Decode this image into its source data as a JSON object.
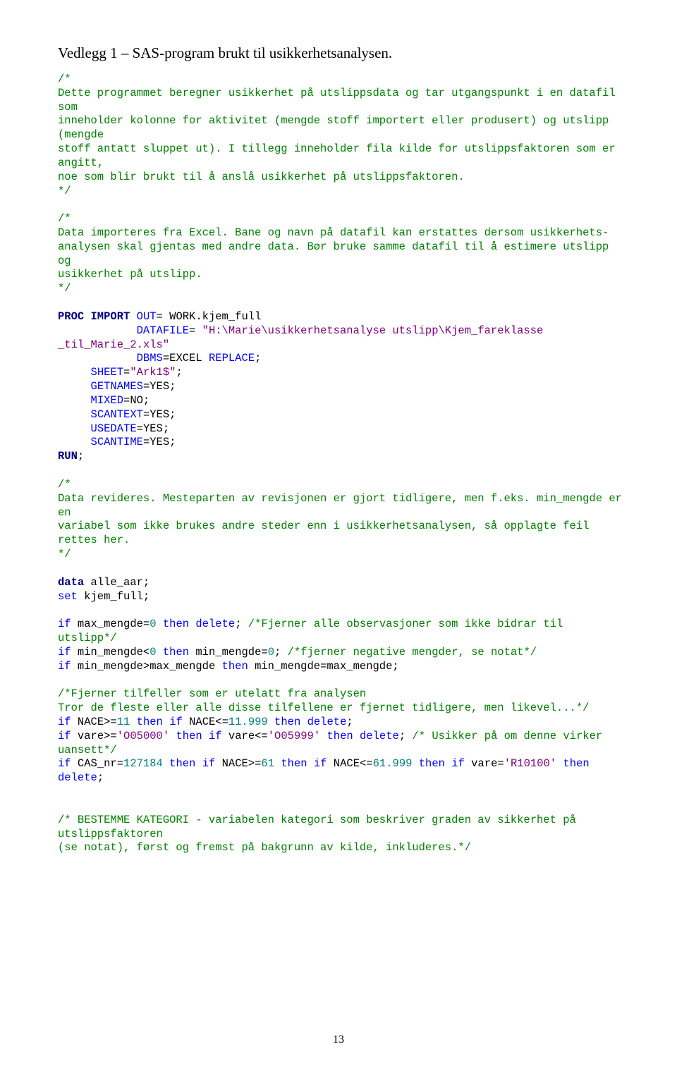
{
  "heading": "Vedlegg 1 – SAS-program brukt til usikkerhetsanalysen.",
  "page_number": "13",
  "code_spans": [
    {
      "cls": "c-green",
      "text": "/*\nDette programmet beregner usikkerhet på utslippsdata og tar utgangspunkt i en datafil som\ninneholder kolonne for aktivitet (mengde stoff importert eller produsert) og utslipp (mengde\nstoff antatt sluppet ut). I tillegg inneholder fila kilde for utslippsfaktoren som er angitt,\nnoe som blir brukt til å anslå usikkerhet på utslippsfaktoren.\n*/\n\n/*\nData importeres fra Excel. Bane og navn på datafil kan erstattes dersom usikkerhets-\nanalysen skal gjentas med andre data. Bør bruke samme datafil til å estimere utslipp og\nusikkerhet på utslipp.\n*/\n"
    },
    {
      "cls": "c-black",
      "text": "\n"
    },
    {
      "cls": "c-navy",
      "text": "PROC IMPORT"
    },
    {
      "cls": "c-black",
      "text": " "
    },
    {
      "cls": "c-blue",
      "text": "OUT"
    },
    {
      "cls": "c-black",
      "text": "= WORK.kjem_full\n            "
    },
    {
      "cls": "c-blue",
      "text": "DATAFILE"
    },
    {
      "cls": "c-black",
      "text": "= "
    },
    {
      "cls": "c-purple",
      "text": "\"H:\\Marie\\usikkerhetsanalyse utslipp\\Kjem_fareklasse _til_Marie_2.xls\""
    },
    {
      "cls": "c-black",
      "text": "\n            "
    },
    {
      "cls": "c-blue",
      "text": "DBMS"
    },
    {
      "cls": "c-black",
      "text": "=EXCEL "
    },
    {
      "cls": "c-blue",
      "text": "REPLACE"
    },
    {
      "cls": "c-black",
      "text": ";\n     "
    },
    {
      "cls": "c-blue",
      "text": "SHEET"
    },
    {
      "cls": "c-black",
      "text": "="
    },
    {
      "cls": "c-purple",
      "text": "\"Ark1$\""
    },
    {
      "cls": "c-black",
      "text": ";\n     "
    },
    {
      "cls": "c-blue",
      "text": "GETNAMES"
    },
    {
      "cls": "c-black",
      "text": "=YES;\n     "
    },
    {
      "cls": "c-blue",
      "text": "MIXED"
    },
    {
      "cls": "c-black",
      "text": "=NO;\n     "
    },
    {
      "cls": "c-blue",
      "text": "SCANTEXT"
    },
    {
      "cls": "c-black",
      "text": "=YES;\n     "
    },
    {
      "cls": "c-blue",
      "text": "USEDATE"
    },
    {
      "cls": "c-black",
      "text": "=YES;\n     "
    },
    {
      "cls": "c-blue",
      "text": "SCANTIME"
    },
    {
      "cls": "c-black",
      "text": "=YES;\n"
    },
    {
      "cls": "c-navy",
      "text": "RUN"
    },
    {
      "cls": "c-black",
      "text": ";\n\n"
    },
    {
      "cls": "c-green",
      "text": "/*\nData revideres. Mesteparten av revisjonen er gjort tidligere, men f.eks. min_mengde er en\nvariabel som ikke brukes andre steder enn i usikkerhetsanalysen, så opplagte feil rettes her.\n*/\n"
    },
    {
      "cls": "c-black",
      "text": "\n"
    },
    {
      "cls": "c-navy",
      "text": "data"
    },
    {
      "cls": "c-black",
      "text": " alle_aar;\n"
    },
    {
      "cls": "c-blue",
      "text": "set"
    },
    {
      "cls": "c-black",
      "text": " kjem_full;\n\n"
    },
    {
      "cls": "c-blue",
      "text": "if"
    },
    {
      "cls": "c-black",
      "text": " max_mengde="
    },
    {
      "cls": "c-teal",
      "text": "0"
    },
    {
      "cls": "c-black",
      "text": " "
    },
    {
      "cls": "c-blue",
      "text": "then"
    },
    {
      "cls": "c-black",
      "text": " "
    },
    {
      "cls": "c-blue",
      "text": "delete"
    },
    {
      "cls": "c-black",
      "text": "; "
    },
    {
      "cls": "c-green",
      "text": "/*Fjerner alle observasjoner som ikke bidrar til utslipp*/"
    },
    {
      "cls": "c-black",
      "text": "\n"
    },
    {
      "cls": "c-blue",
      "text": "if"
    },
    {
      "cls": "c-black",
      "text": " min_mengde<"
    },
    {
      "cls": "c-teal",
      "text": "0"
    },
    {
      "cls": "c-black",
      "text": " "
    },
    {
      "cls": "c-blue",
      "text": "then"
    },
    {
      "cls": "c-black",
      "text": " min_mengde="
    },
    {
      "cls": "c-teal",
      "text": "0"
    },
    {
      "cls": "c-black",
      "text": "; "
    },
    {
      "cls": "c-green",
      "text": "/*fjerner negative mengder, se notat*/"
    },
    {
      "cls": "c-black",
      "text": "\n"
    },
    {
      "cls": "c-blue",
      "text": "if"
    },
    {
      "cls": "c-black",
      "text": " min_mengde>max_mengde "
    },
    {
      "cls": "c-blue",
      "text": "then"
    },
    {
      "cls": "c-black",
      "text": " min_mengde=max_mengde;\n\n"
    },
    {
      "cls": "c-green",
      "text": "/*Fjerner tilfeller som er utelatt fra analysen\nTror de fleste eller alle disse tilfellene er fjernet tidligere, men likevel...*/"
    },
    {
      "cls": "c-black",
      "text": "\n"
    },
    {
      "cls": "c-blue",
      "text": "if"
    },
    {
      "cls": "c-black",
      "text": " NACE>="
    },
    {
      "cls": "c-teal",
      "text": "11"
    },
    {
      "cls": "c-black",
      "text": " "
    },
    {
      "cls": "c-blue",
      "text": "then"
    },
    {
      "cls": "c-black",
      "text": " "
    },
    {
      "cls": "c-blue",
      "text": "if"
    },
    {
      "cls": "c-black",
      "text": " NACE<="
    },
    {
      "cls": "c-teal",
      "text": "11.999"
    },
    {
      "cls": "c-black",
      "text": " "
    },
    {
      "cls": "c-blue",
      "text": "then"
    },
    {
      "cls": "c-black",
      "text": " "
    },
    {
      "cls": "c-blue",
      "text": "delete"
    },
    {
      "cls": "c-black",
      "text": ";\n"
    },
    {
      "cls": "c-blue",
      "text": "if"
    },
    {
      "cls": "c-black",
      "text": " vare>="
    },
    {
      "cls": "c-purple",
      "text": "'O05000'"
    },
    {
      "cls": "c-black",
      "text": " "
    },
    {
      "cls": "c-blue",
      "text": "then"
    },
    {
      "cls": "c-black",
      "text": " "
    },
    {
      "cls": "c-blue",
      "text": "if"
    },
    {
      "cls": "c-black",
      "text": " vare<="
    },
    {
      "cls": "c-purple",
      "text": "'O05999'"
    },
    {
      "cls": "c-black",
      "text": " "
    },
    {
      "cls": "c-blue",
      "text": "then"
    },
    {
      "cls": "c-black",
      "text": " "
    },
    {
      "cls": "c-blue",
      "text": "delete"
    },
    {
      "cls": "c-black",
      "text": "; "
    },
    {
      "cls": "c-green",
      "text": "/* Usikker på om denne virker uansett*/"
    },
    {
      "cls": "c-black",
      "text": "\n"
    },
    {
      "cls": "c-blue",
      "text": "if"
    },
    {
      "cls": "c-black",
      "text": " CAS_nr="
    },
    {
      "cls": "c-teal",
      "text": "127184"
    },
    {
      "cls": "c-black",
      "text": " "
    },
    {
      "cls": "c-blue",
      "text": "then"
    },
    {
      "cls": "c-black",
      "text": " "
    },
    {
      "cls": "c-blue",
      "text": "if"
    },
    {
      "cls": "c-black",
      "text": " NACE>="
    },
    {
      "cls": "c-teal",
      "text": "61"
    },
    {
      "cls": "c-black",
      "text": " "
    },
    {
      "cls": "c-blue",
      "text": "then"
    },
    {
      "cls": "c-black",
      "text": " "
    },
    {
      "cls": "c-blue",
      "text": "if"
    },
    {
      "cls": "c-black",
      "text": " NACE<="
    },
    {
      "cls": "c-teal",
      "text": "61.999"
    },
    {
      "cls": "c-black",
      "text": " "
    },
    {
      "cls": "c-blue",
      "text": "then"
    },
    {
      "cls": "c-black",
      "text": " "
    },
    {
      "cls": "c-blue",
      "text": "if"
    },
    {
      "cls": "c-black",
      "text": " vare="
    },
    {
      "cls": "c-purple",
      "text": "'R10100'"
    },
    {
      "cls": "c-black",
      "text": " "
    },
    {
      "cls": "c-blue",
      "text": "then"
    },
    {
      "cls": "c-black",
      "text": " "
    },
    {
      "cls": "c-blue",
      "text": "delete"
    },
    {
      "cls": "c-black",
      "text": ";\n\n\n"
    },
    {
      "cls": "c-green",
      "text": "/* BESTEMME KATEGORI - variabelen kategori som beskriver graden av sikkerhet på utslippsfaktoren\n(se notat), først og fremst på bakgrunn av kilde, inkluderes.*/"
    }
  ]
}
